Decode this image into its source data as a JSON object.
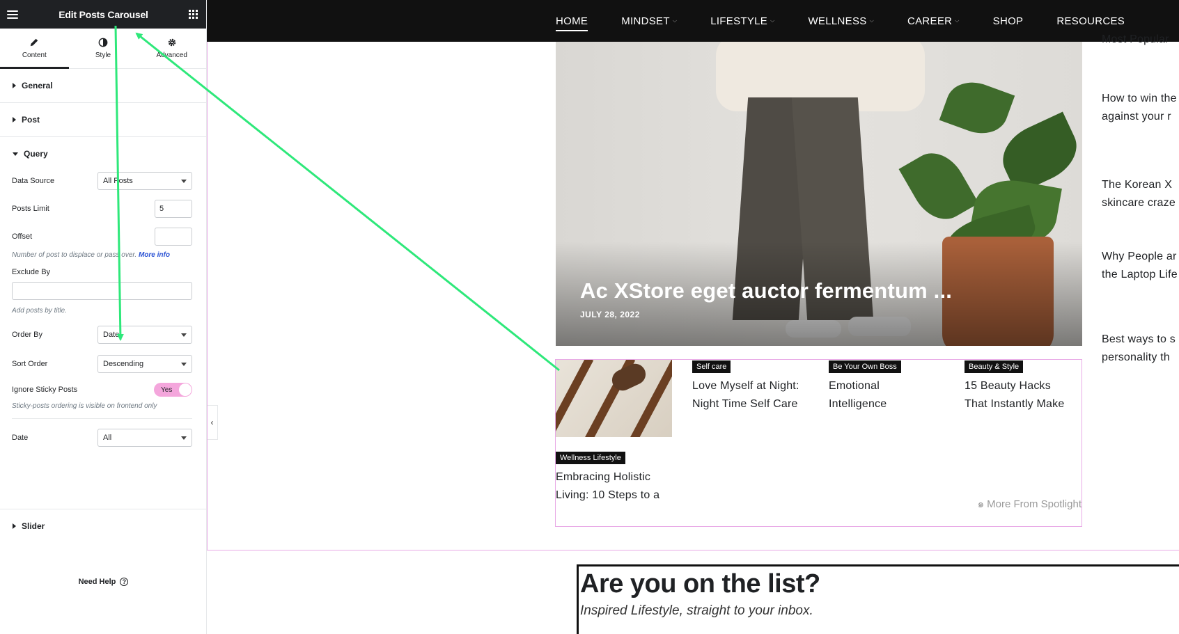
{
  "panel": {
    "title": "Edit Posts Carousel",
    "tabs": [
      {
        "label": "Content",
        "icon": "pencil-icon",
        "active": true
      },
      {
        "label": "Style",
        "icon": "half-circle-icon",
        "active": false
      },
      {
        "label": "Advanced",
        "icon": "gear-icon",
        "active": false
      }
    ],
    "sections": {
      "general": "General",
      "post": "Post",
      "query": "Query",
      "slider": "Slider"
    },
    "query": {
      "data_source_label": "Data Source",
      "data_source_value": "All Posts",
      "posts_limit_label": "Posts Limit",
      "posts_limit_value": "5",
      "offset_label": "Offset",
      "offset_value": "",
      "offset_help": "Number of post to displace or pass over.",
      "offset_help_link": "More info",
      "exclude_label": "Exclude By",
      "exclude_value": "",
      "exclude_help": "Add posts by title.",
      "order_by_label": "Order By",
      "order_by_value": "Date",
      "sort_order_label": "Sort Order",
      "sort_order_value": "Descending",
      "sticky_label": "Ignore Sticky Posts",
      "sticky_value": "Yes",
      "sticky_help": "Sticky-posts ordering is visible on frontend only",
      "date_label": "Date",
      "date_value": "All"
    },
    "need_help": "Need Help"
  },
  "nav": {
    "items": [
      {
        "label": "HOME",
        "dropdown": false
      },
      {
        "label": "MINDSET",
        "dropdown": true
      },
      {
        "label": "LIFESTYLE",
        "dropdown": true
      },
      {
        "label": "WELLNESS",
        "dropdown": true
      },
      {
        "label": "CAREER",
        "dropdown": true
      },
      {
        "label": "SHOP",
        "dropdown": false
      },
      {
        "label": "RESOURCES",
        "dropdown": false
      }
    ]
  },
  "hero": {
    "title": "Ac XStore eget auctor fermentum ...",
    "date": "JULY 28, 2022"
  },
  "carousel": {
    "cards": [
      {
        "badge": "Self care",
        "title_line1": "Love Myself at Night:",
        "title_line2": "Night Time Self Care"
      },
      {
        "badge": "Be Your Own Boss",
        "title_line1": "Emotional",
        "title_line2": "Intelligence"
      },
      {
        "badge": "Beauty & Style",
        "title_line1": "15 Beauty Hacks",
        "title_line2": "That Instantly Make"
      },
      {
        "badge": "Wellness Lifestyle",
        "title_line1": "Embracing Holistic",
        "title_line2": "Living: 10 Steps to a"
      }
    ],
    "more_from": "More From Spotlight"
  },
  "sidebar_posts": {
    "items": [
      {
        "line1": "Most Popular",
        "line2": ""
      },
      {
        "line1": "How to win the",
        "line2": "against your r"
      },
      {
        "line1": "The Korean X",
        "line2": "skincare craze"
      },
      {
        "line1": "Why People ar",
        "line2": "the Laptop Life"
      },
      {
        "line1": "Best ways to s",
        "line2": "personality th"
      }
    ]
  },
  "newsletter": {
    "title": "Are you on the list?",
    "subtitle": "Inspired Lifestyle, straight to your inbox."
  },
  "colors": {
    "annotation_arrow": "#2ee87a",
    "accent_border": "#e8a9e6",
    "toggle_on": "#f4a6dc"
  }
}
